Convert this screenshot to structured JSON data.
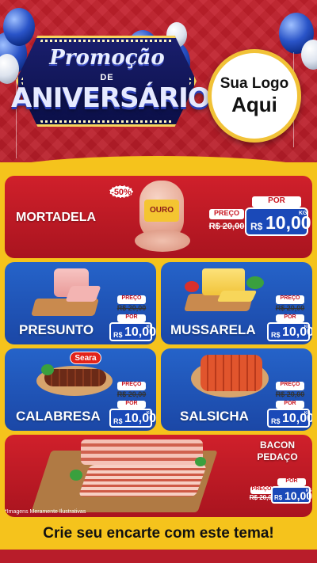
{
  "header": {
    "title_line1": "Promoção",
    "title_line2": "DE",
    "title_line3": "ANIVERSÁRIO",
    "logo_line1": "Sua Logo",
    "logo_line2": "Aqui"
  },
  "products": {
    "mortadela": {
      "name": "MORTADELA",
      "discount": "-50%",
      "brand": "OURO",
      "price_label": "PREÇO",
      "old_price": "R$ 20,00",
      "por_label": "POR",
      "currency": "R$",
      "new_price": "10,00",
      "unit": "KG"
    },
    "presunto": {
      "name": "PRESUNTO",
      "price_label": "PREÇO",
      "old_price": "R$ 20,00",
      "por_label": "POR",
      "currency": "R$",
      "new_price": "10,00",
      "unit": "KG"
    },
    "mussarela": {
      "name": "MUSSARELA",
      "price_label": "PREÇO",
      "old_price": "R$ 20,00",
      "por_label": "POR",
      "currency": "R$",
      "new_price": "10,00",
      "unit": "KG"
    },
    "calabresa": {
      "name": "CALABRESA",
      "brand": "Seara",
      "price_label": "PREÇO",
      "old_price": "R$ 20,00",
      "por_label": "POR",
      "currency": "R$",
      "new_price": "10,00",
      "unit": "KG"
    },
    "salsicha": {
      "name": "SALSICHA",
      "price_label": "PREÇO",
      "old_price": "R$ 20,00",
      "por_label": "POR",
      "currency": "R$",
      "new_price": "10,00",
      "unit": "KG"
    },
    "bacon": {
      "name_line1": "BACON",
      "name_line2": "PEDAÇO",
      "price_label": "PREÇO",
      "old_price": "R$ 20,00",
      "por_label": "POR",
      "currency": "R$",
      "new_price": "10,00",
      "unit": "KG"
    }
  },
  "footer": {
    "note": "*Imagens Meramente Ilustrativas",
    "cta": "Crie seu encarte com este tema!"
  },
  "colors": {
    "red": "#c3202c",
    "blue": "#1a49b8",
    "yellow": "#f5c31c"
  }
}
